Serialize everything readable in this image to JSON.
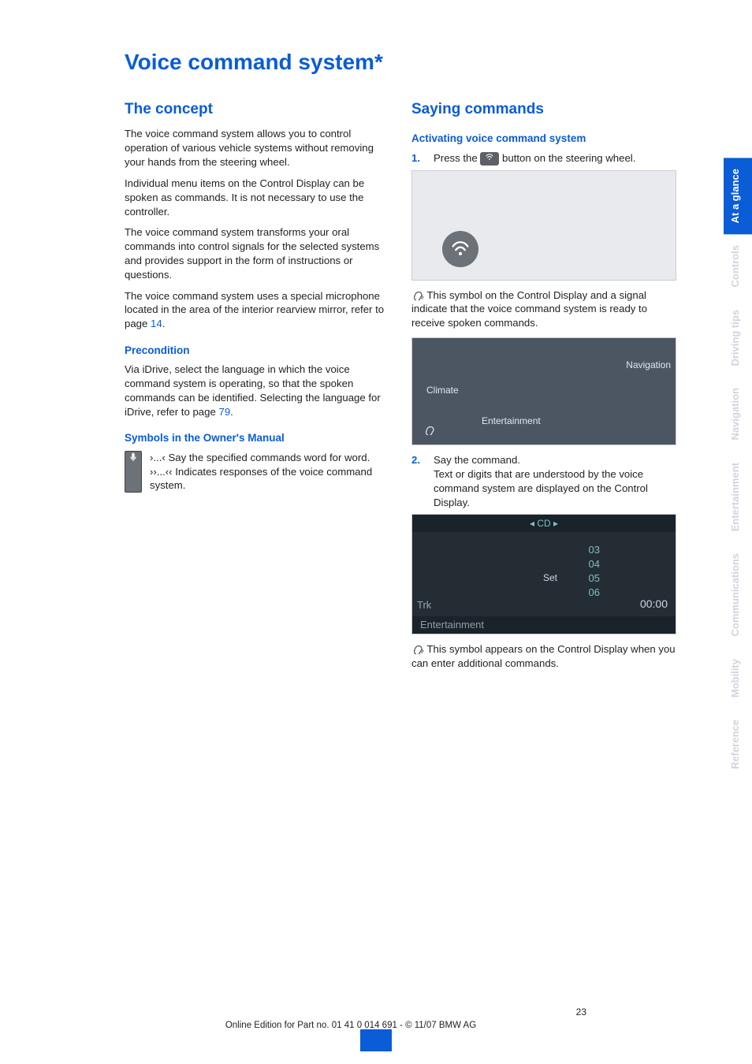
{
  "title": "Voice command system*",
  "page_number": "23",
  "footer": "Online Edition for Part no. 01 41 0 014 691 - © 11/07 BMW AG",
  "tabs": {
    "at_a_glance": "At a glance",
    "controls": "Controls",
    "driving_tips": "Driving tips",
    "navigation": "Navigation",
    "entertainment": "Entertainment",
    "communications": "Communications",
    "mobility": "Mobility",
    "reference": "Reference"
  },
  "left": {
    "h2": "The concept",
    "p1": "The voice command system allows you to control operation of various vehicle systems without removing your hands from the steering wheel.",
    "p2": "Individual menu items on the Control Display can be spoken as commands. It is not necessary to use the controller.",
    "p3": "The voice command system transforms your oral commands into control signals for the selected systems and provides support in the form of instructions or questions.",
    "p4a": "The voice command system uses a special microphone located in the area of the interior rearview mirror, refer to page ",
    "p4_link": "14",
    "p4b": ".",
    "h3a": "Precondition",
    "p5a": "Via iDrive, select the language in which the voice command system is operating, so that the spoken commands can be identified. Selecting the language for iDrive, refer to page ",
    "p5_link": "79",
    "p5b": ".",
    "h3b": "Symbols in the Owner's Manual",
    "s1_pre": "›...‹",
    "s1": " Say the specified commands word for word.",
    "s2_pre": "››...‹‹",
    "s2": " Indicates responses of the voice command system."
  },
  "right": {
    "h2": "Saying commands",
    "h3a": "Activating voice command system",
    "step1_num": "1.",
    "step1a": "Press the ",
    "step1b": " button on the steering wheel.",
    "p_after_fig1": " This symbol on the Control Display and a signal indicate that the voice command system is ready to receive spoken commands.",
    "step2_num": "2.",
    "step2a": "Say the command.",
    "step2b": "Text or digits that are understood by the voice command system are displayed on the Control Display.",
    "p_after_fig3": " This symbol appears on the Control Display when you can enter additional commands.",
    "fig2": {
      "climate": "Climate",
      "navigation": "Navigation",
      "entertainment": "Entertainment"
    },
    "fig3": {
      "top": "◂   CD   ▸",
      "t1": "03",
      "t2": "04",
      "t3": "05",
      "t4": "06",
      "set": "Set",
      "time": "00:00",
      "trk": "Trk",
      "bottom": "Entertainment"
    }
  }
}
